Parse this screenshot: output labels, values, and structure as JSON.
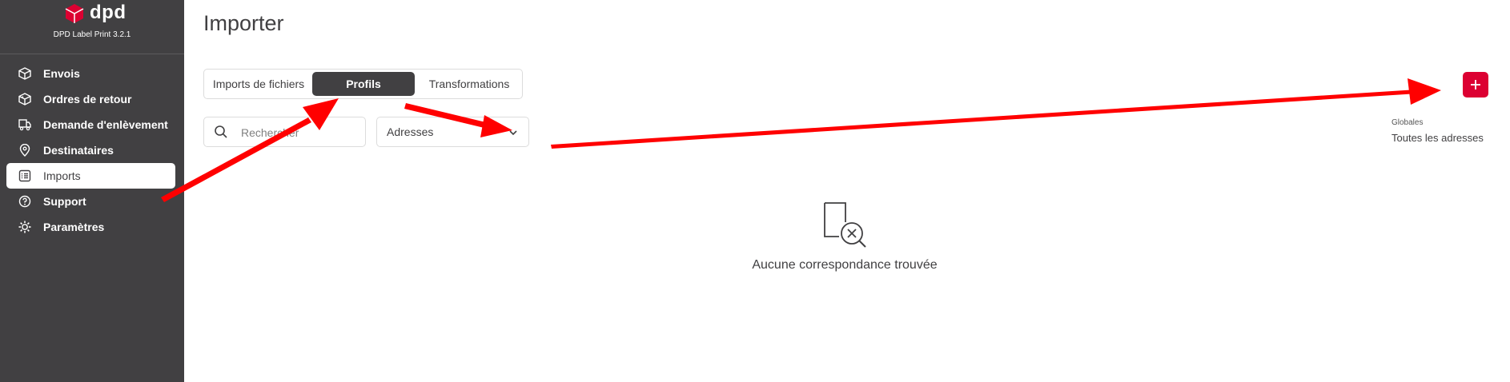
{
  "brand": {
    "name": "dpd",
    "version": "DPD Label Print 3.2.1",
    "color": "#dc0032"
  },
  "sidebar": {
    "background": "#414042",
    "items": [
      {
        "label": "Envois",
        "icon": "box-icon",
        "active": false
      },
      {
        "label": "Ordres de retour",
        "icon": "return-box-icon",
        "active": false
      },
      {
        "label": "Demande d'enlèvement",
        "icon": "truck-icon",
        "active": false
      },
      {
        "label": "Destinataires",
        "icon": "location-pin-icon",
        "active": false
      },
      {
        "label": "Imports",
        "icon": "list-icon",
        "active": true
      },
      {
        "label": "Support",
        "icon": "help-icon",
        "active": false
      },
      {
        "label": "Paramètres",
        "icon": "gear-icon",
        "active": false
      }
    ]
  },
  "main": {
    "title": "Importer",
    "tabs": [
      {
        "label": "Imports de fichiers",
        "active": false
      },
      {
        "label": "Profils",
        "active": true
      },
      {
        "label": "Transformations",
        "active": false
      }
    ],
    "search": {
      "placeholder": "Rechercher",
      "value": ""
    },
    "filter": {
      "selected": "Adresses"
    },
    "add_button": {
      "icon": "plus-icon",
      "color": "#dc0032"
    },
    "scope": {
      "label": "Globales",
      "value": "Toutes les adresses"
    },
    "empty_state": {
      "icon": "no-match-icon",
      "text": "Aucune correspondance trouvée"
    }
  },
  "annotations": {
    "arrow_color": "#ff0000",
    "arrows": [
      "arrow-to-profils-tab",
      "arrow-to-filter-dropdown",
      "arrow-to-add-button"
    ]
  }
}
